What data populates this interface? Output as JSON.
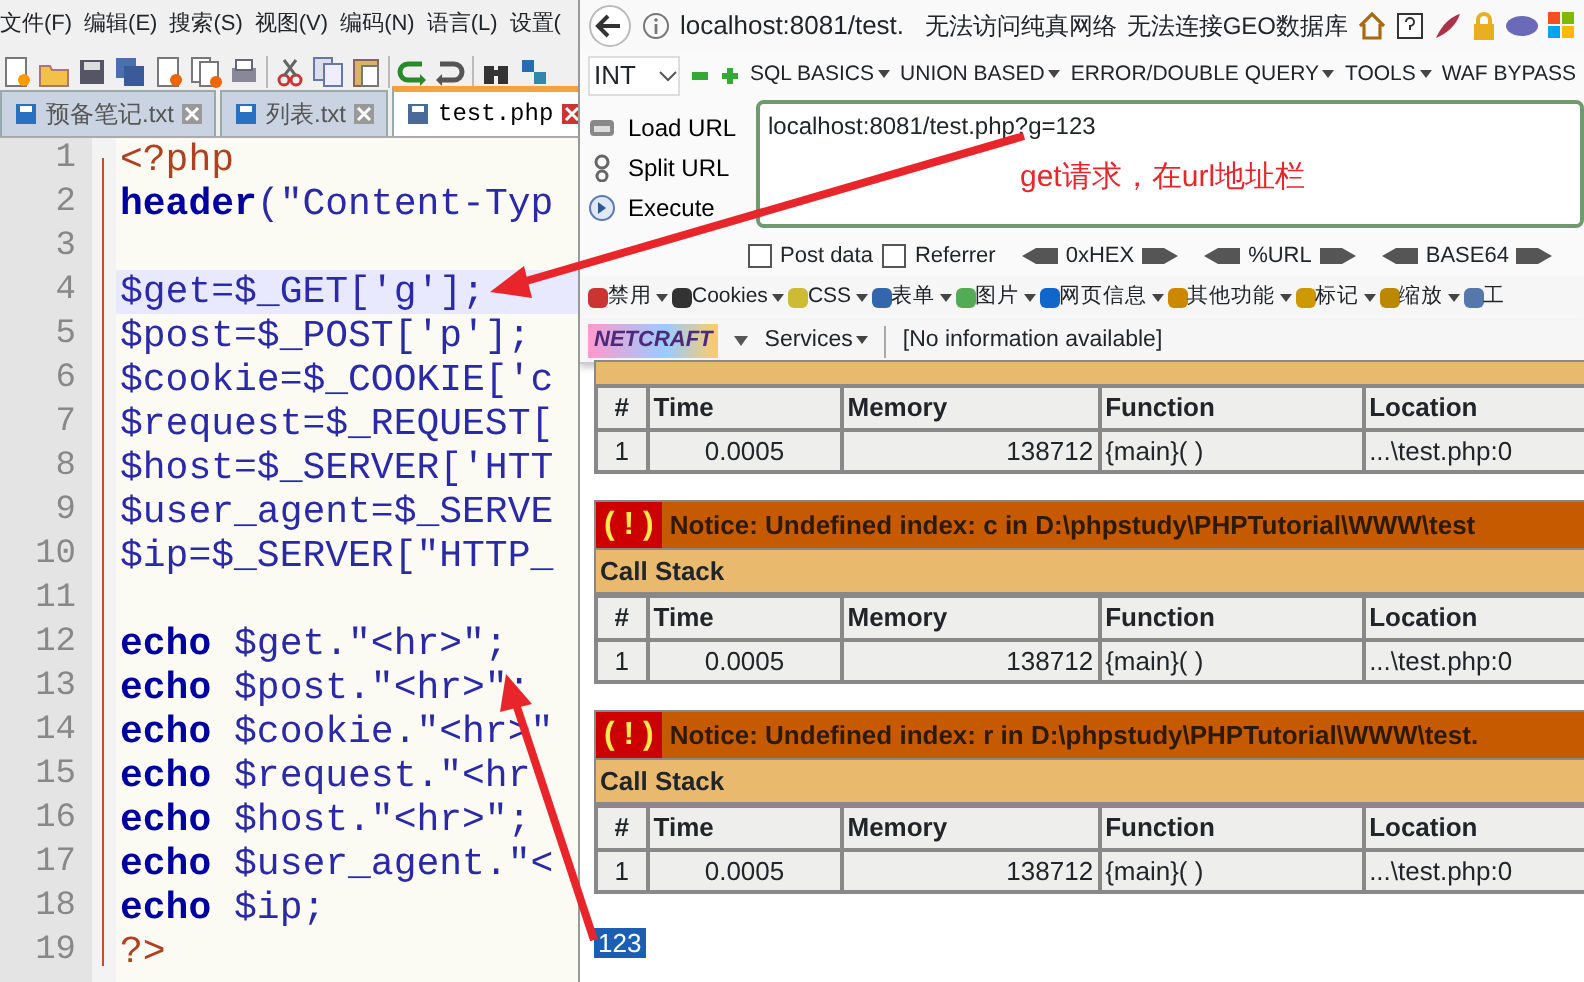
{
  "editor": {
    "menu": [
      "文件(F)",
      "编辑(E)",
      "搜索(S)",
      "视图(V)",
      "编码(N)",
      "语言(L)",
      "设置("
    ],
    "tabs": [
      {
        "label": "预备笔记.txt",
        "selected": false
      },
      {
        "label": "列表.txt",
        "selected": false
      },
      {
        "label": "test.php",
        "selected": true
      }
    ],
    "lines": [
      {
        "number": "1",
        "kind": "tag",
        "text": "<?php",
        "highlighted": false
      },
      {
        "number": "2",
        "kind": "code",
        "keyword": "header",
        "text": "(\"Content-Typ",
        "highlighted": false
      },
      {
        "number": "3",
        "kind": "blank",
        "highlighted": false
      },
      {
        "number": "4",
        "kind": "code",
        "text": "$get=$_GET['g'];",
        "highlighted": true
      },
      {
        "number": "5",
        "kind": "code",
        "text": "$post=$_POST['p'];",
        "highlighted": false
      },
      {
        "number": "6",
        "kind": "code",
        "text": "$cookie=$_COOKIE['c",
        "highlighted": false
      },
      {
        "number": "7",
        "kind": "code",
        "text": "$request=$_REQUEST[",
        "highlighted": false
      },
      {
        "number": "8",
        "kind": "code",
        "text": "$host=$_SERVER['HTT",
        "highlighted": false
      },
      {
        "number": "9",
        "kind": "code",
        "text": "$user_agent=$_SERVE",
        "highlighted": false
      },
      {
        "number": "10",
        "kind": "code",
        "text": "$ip=$_SERVER[\"HTTP_",
        "highlighted": false
      },
      {
        "number": "11",
        "kind": "blank",
        "highlighted": false
      },
      {
        "number": "12",
        "kind": "code",
        "keyword": "echo",
        "text": " $get.\"<hr>\";",
        "highlighted": false
      },
      {
        "number": "13",
        "kind": "code",
        "keyword": "echo",
        "text": " $post.\"<hr>\";",
        "highlighted": false
      },
      {
        "number": "14",
        "kind": "code",
        "keyword": "echo",
        "text": " $cookie.\"<hr>\"",
        "highlighted": false
      },
      {
        "number": "15",
        "kind": "code",
        "keyword": "echo",
        "text": " $request.\"<hr",
        "highlighted": false
      },
      {
        "number": "16",
        "kind": "code",
        "keyword": "echo",
        "text": " $host.\"<hr>\";",
        "highlighted": false
      },
      {
        "number": "17",
        "kind": "code",
        "keyword": "echo",
        "text": " $user_agent.\"<",
        "highlighted": false
      },
      {
        "number": "18",
        "kind": "code",
        "keyword": "echo",
        "text": " $ip;",
        "highlighted": false
      },
      {
        "number": "19",
        "kind": "tag",
        "text": "?>",
        "highlighted": false
      }
    ]
  },
  "browser": {
    "address": "localhost:8081/test.",
    "bookmarks": [
      "无法访问纯真网络",
      "无法连接GEO数据库"
    ],
    "hackbar": {
      "select": "INT",
      "menus": [
        "SQL BASICS",
        "UNION BASED",
        "ERROR/DOUBLE QUERY",
        "TOOLS",
        "WAF BYPASS"
      ],
      "actions": [
        "Load URL",
        "Split URL",
        "Execute"
      ],
      "url": "localhost:8081/test.php?g=123",
      "options": [
        {
          "label": "Post data",
          "checked": false
        },
        {
          "label": "Referrer",
          "checked": false
        }
      ],
      "encoders": [
        "0xHEX",
        "%URL",
        "BASE64"
      ]
    },
    "webdev": [
      "禁用",
      "Cookies",
      "CSS",
      "表单",
      "图片",
      "网页信息",
      "其他功能",
      "标记",
      "缩放",
      "工"
    ],
    "netcraft": {
      "logo": "NETCRAFT",
      "services": "Services",
      "info": "[No information available]"
    },
    "errors": [
      {
        "columns": [
          "#",
          "Time",
          "Memory",
          "Function",
          "Location"
        ],
        "row": [
          "1",
          "0.0005",
          "138712",
          "{main}( )",
          "...\\test.php:0"
        ]
      },
      {
        "icon": "( ! )",
        "notice": "Notice: Undefined index: c in D:\\phpstudy\\PHPTutorial\\WWW\\test",
        "call_stack": "Call Stack",
        "columns": [
          "#",
          "Time",
          "Memory",
          "Function",
          "Location"
        ],
        "row": [
          "1",
          "0.0005",
          "138712",
          "{main}( )",
          "...\\test.php:0"
        ]
      },
      {
        "icon": "( ! )",
        "notice": "Notice: Undefined index: r in D:\\phpstudy\\PHPTutorial\\WWW\\test.",
        "call_stack": "Call Stack",
        "columns": [
          "#",
          "Time",
          "Memory",
          "Function",
          "Location"
        ],
        "row": [
          "1",
          "0.0005",
          "138712",
          "{main}( )",
          "...\\test.php:0"
        ]
      }
    ],
    "output": {
      "text": "123",
      "selected": true
    }
  },
  "annotation": {
    "text": "get请求，在url地址栏"
  }
}
